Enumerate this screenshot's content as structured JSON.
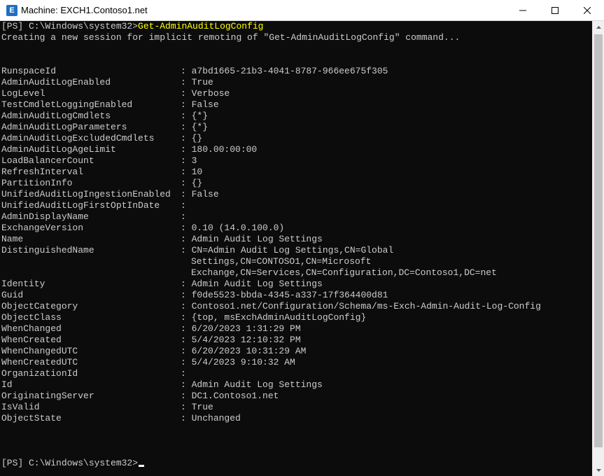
{
  "window": {
    "title": "Machine: EXCH1.Contoso1.net",
    "app_icon": "exchange-shell-icon",
    "controls": {
      "minimize": "minimize-icon",
      "maximize": "maximize-icon",
      "close": "close-icon"
    }
  },
  "console": {
    "prompt1": "[PS] C:\\Windows\\system32>",
    "command": "Get-AdminAuditLogConfig",
    "status": "Creating a new session for implicit remoting of \"Get-AdminAuditLogConfig\" command...",
    "properties": [
      {
        "name": "RunspaceId",
        "value": "a7bd1665-21b3-4041-8787-966ee675f305"
      },
      {
        "name": "AdminAuditLogEnabled",
        "value": "True"
      },
      {
        "name": "LogLevel",
        "value": "Verbose"
      },
      {
        "name": "TestCmdletLoggingEnabled",
        "value": "False"
      },
      {
        "name": "AdminAuditLogCmdlets",
        "value": "{*}"
      },
      {
        "name": "AdminAuditLogParameters",
        "value": "{*}"
      },
      {
        "name": "AdminAuditLogExcludedCmdlets",
        "value": "{}"
      },
      {
        "name": "AdminAuditLogAgeLimit",
        "value": "180.00:00:00"
      },
      {
        "name": "LoadBalancerCount",
        "value": "3"
      },
      {
        "name": "RefreshInterval",
        "value": "10"
      },
      {
        "name": "PartitionInfo",
        "value": "{}"
      },
      {
        "name": "UnifiedAuditLogIngestionEnabled",
        "value": "False"
      },
      {
        "name": "UnifiedAuditLogFirstOptInDate",
        "value": ""
      },
      {
        "name": "AdminDisplayName",
        "value": ""
      },
      {
        "name": "ExchangeVersion",
        "value": "0.10 (14.0.100.0)"
      },
      {
        "name": "Name",
        "value": "Admin Audit Log Settings"
      },
      {
        "name": "DistinguishedName",
        "value": "CN=Admin Audit Log Settings,CN=Global",
        "continuation": [
          "Settings,CN=CONTOSO1,CN=Microsoft",
          "Exchange,CN=Services,CN=Configuration,DC=Contoso1,DC=net"
        ]
      },
      {
        "name": "Identity",
        "value": "Admin Audit Log Settings"
      },
      {
        "name": "Guid",
        "value": "f0de5523-bbda-4345-a337-17f364400d81"
      },
      {
        "name": "ObjectCategory",
        "value": "Contoso1.net/Configuration/Schema/ms-Exch-Admin-Audit-Log-Config"
      },
      {
        "name": "ObjectClass",
        "value": "{top, msExchAdminAuditLogConfig}"
      },
      {
        "name": "WhenChanged",
        "value": "6/20/2023 1:31:29 PM"
      },
      {
        "name": "WhenCreated",
        "value": "5/4/2023 12:10:32 PM"
      },
      {
        "name": "WhenChangedUTC",
        "value": "6/20/2023 10:31:29 AM"
      },
      {
        "name": "WhenCreatedUTC",
        "value": "5/4/2023 9:10:32 AM"
      },
      {
        "name": "OrganizationId",
        "value": ""
      },
      {
        "name": "Id",
        "value": "Admin Audit Log Settings"
      },
      {
        "name": "OriginatingServer",
        "value": "DC1.Contoso1.net"
      },
      {
        "name": "IsValid",
        "value": "True"
      },
      {
        "name": "ObjectState",
        "value": "Unchanged"
      }
    ],
    "prompt2": "[PS] C:\\Windows\\system32>"
  },
  "scrollbar": {
    "up": "scroll-up-arrow-icon",
    "down": "scroll-down-arrow-icon"
  },
  "colors": {
    "background": "#0c0c0c",
    "text": "#cccccc",
    "command": "#ffff00",
    "titlebar": "#ffffff"
  }
}
